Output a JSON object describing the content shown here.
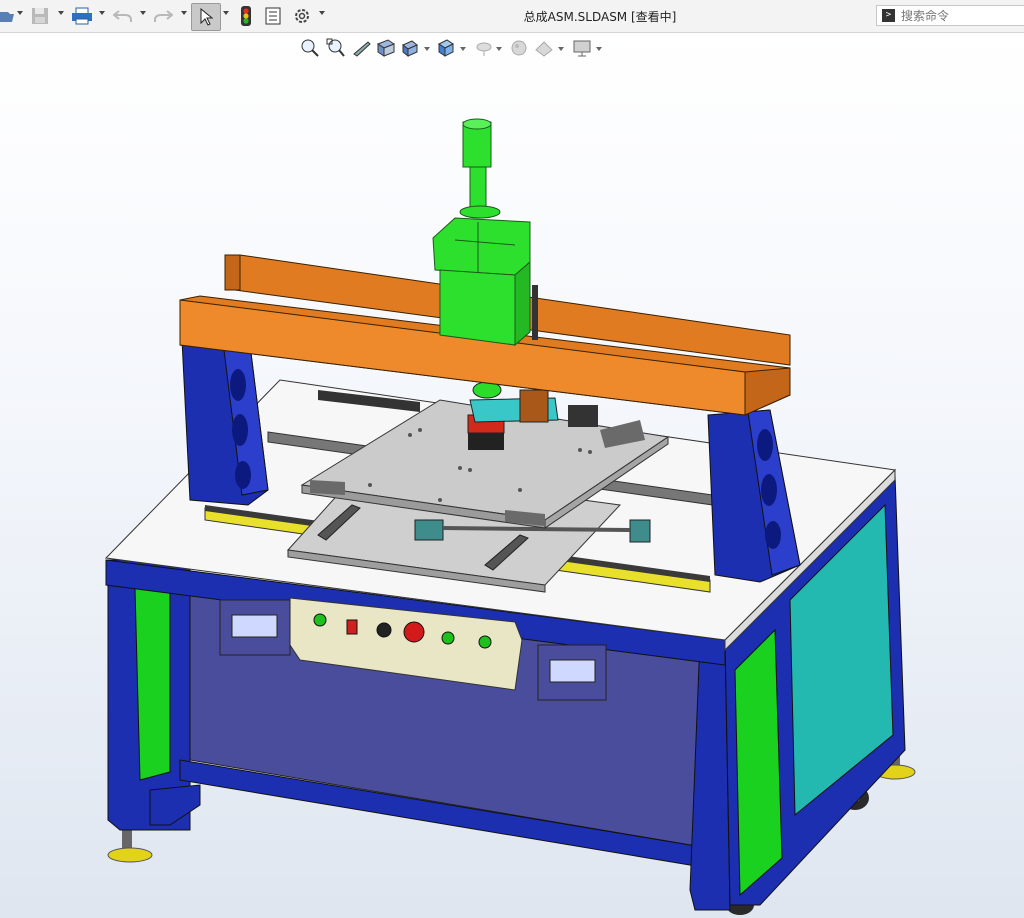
{
  "window": {
    "title": "总成ASM.SLDASM [查看中]"
  },
  "toolbar": {
    "buttons": [
      {
        "name": "open-icon",
        "has_dropdown": true
      },
      {
        "name": "save-icon",
        "has_dropdown": true
      },
      {
        "name": "print-icon",
        "has_dropdown": true
      },
      {
        "name": "undo-icon",
        "has_dropdown": true
      },
      {
        "name": "redo-icon",
        "has_dropdown": true
      },
      {
        "name": "select-pointer-icon",
        "has_dropdown": true
      },
      {
        "name": "rebuild-traffic-light-icon",
        "has_dropdown": false
      },
      {
        "name": "file-properties-icon",
        "has_dropdown": false
      },
      {
        "name": "options-gear-icon",
        "has_dropdown": true
      }
    ]
  },
  "search": {
    "placeholder": "搜索命令",
    "prompt_symbol": ">"
  },
  "heads_up_toolbar": {
    "buttons": [
      "zoom-to-fit-icon",
      "zoom-to-area-icon",
      "previous-view-icon",
      "section-view-icon",
      "view-orientation-icon",
      "display-style-icon",
      "hide-show-items-icon",
      "edit-appearance-icon",
      "apply-scene-icon",
      "view-settings-icon"
    ]
  },
  "model": {
    "panel_indicators": [
      "green",
      "red-switch",
      "black-knob",
      "red-estop",
      "green",
      "green"
    ],
    "colors": {
      "frame_blue": "#1c2fb0",
      "panel_green": "#19d11e",
      "panel_teal": "#23b8b0",
      "beam_orange": "#e07b22",
      "cylinder_green": "#2ee02e",
      "table_white": "#f7f7f7",
      "plate_gray": "#c8c8c8",
      "control_panel": "#e9e6c6",
      "inner_blue": "#4a4d9c"
    }
  }
}
